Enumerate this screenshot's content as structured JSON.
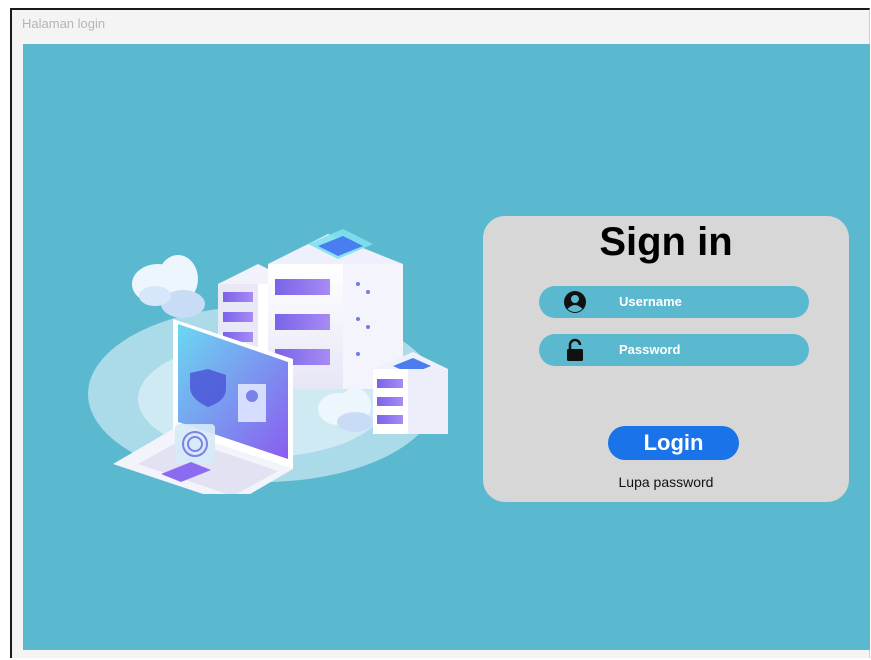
{
  "window": {
    "title": "Halaman login"
  },
  "login": {
    "title": "Sign in",
    "username_label": "Username",
    "password_label": "Password",
    "login_button": "Login",
    "forgot_link": "Lupa password"
  },
  "icons": {
    "username": "user-icon",
    "password": "lock-icon"
  },
  "colors": {
    "background": "#5bb9cf",
    "card": "#d7d7d7",
    "field": "#5bb9cf",
    "button": "#1a73e8",
    "title_bar_text": "#b5b5b5"
  }
}
